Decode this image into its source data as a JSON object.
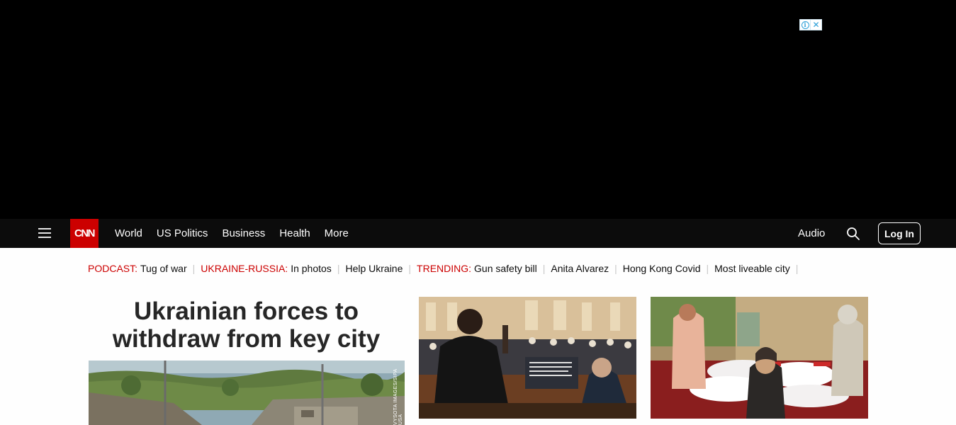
{
  "ad": {
    "info_icon": "info-icon",
    "close_icon": "close-icon",
    "info_glyph": "i",
    "close_glyph": "✕"
  },
  "nav": {
    "logo": "CNN",
    "links": [
      "World",
      "US Politics",
      "Business",
      "Health",
      "More"
    ],
    "audio": "Audio",
    "login": "Log In"
  },
  "subnav": {
    "podcast_tag": "PODCAST:",
    "podcast_link": "Tug of war",
    "ukraine_tag": "UKRAINE-RUSSIA:",
    "ukraine_link1": "In photos",
    "ukraine_link2": "Help Ukraine",
    "trending_tag": "TRENDING:",
    "trending_links": [
      "Gun safety bill",
      "Anita Alvarez",
      "Hong Kong Covid",
      "Most liveable city"
    ]
  },
  "main": {
    "headline": "Ukrainian forces to withdraw from key city",
    "photo_credit": "VYSOTA IMAGES/SIPA USA"
  },
  "colors": {
    "brand_red": "#cc0000",
    "nav_bg": "#0c0c0c"
  }
}
